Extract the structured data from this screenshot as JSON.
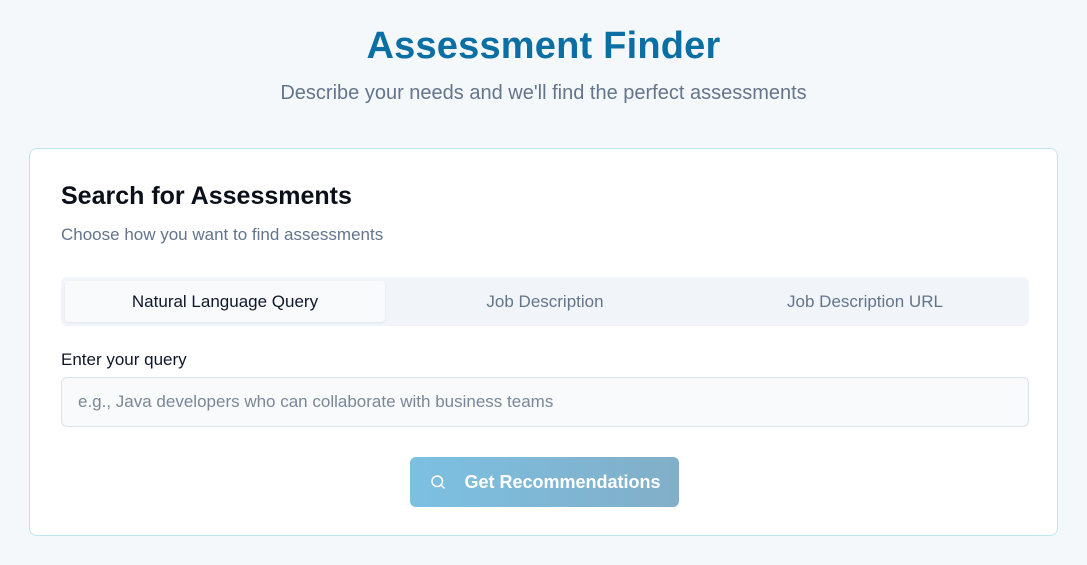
{
  "header": {
    "title": "Assessment Finder",
    "subtitle": "Describe your needs and we'll find the perfect assessments"
  },
  "card": {
    "title": "Search for Assessments",
    "description": "Choose how you want to find assessments",
    "tabs": [
      {
        "label": "Natural Language Query",
        "active": true
      },
      {
        "label": "Job Description",
        "active": false
      },
      {
        "label": "Job Description URL",
        "active": false
      }
    ],
    "query": {
      "label": "Enter your query",
      "value": "",
      "placeholder": "e.g., Java developers who can collaborate with business teams"
    },
    "submit": {
      "label": "Get Recommendations",
      "icon": "search-icon"
    }
  },
  "colors": {
    "title": "#0b6fa4",
    "page_background": "#f5f8fb",
    "card_border": "#bfe6f0",
    "button_gradient_start": "#7cc0e2",
    "button_gradient_end": "#82aec8"
  }
}
